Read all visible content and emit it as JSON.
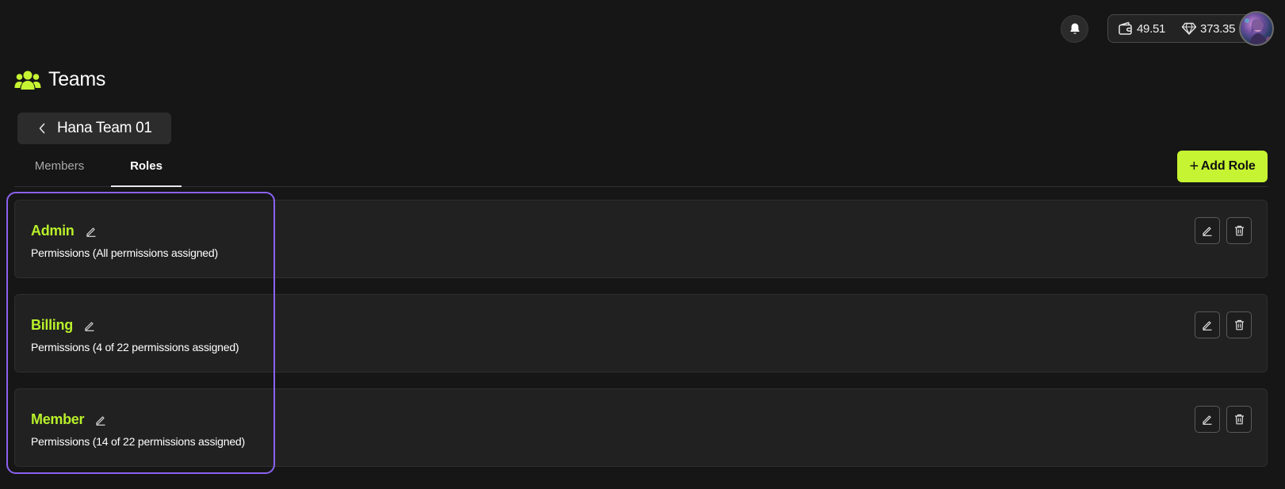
{
  "topbar": {
    "wallet_balance": "49.51",
    "gem_balance": "373.35",
    "icons": [
      "bell-icon",
      "wallet-icon",
      "diamond-icon"
    ]
  },
  "header": {
    "title": "Teams",
    "team_name": "Hana Team 01"
  },
  "tabs": [
    {
      "label": "Members",
      "active": false
    },
    {
      "label": "Roles",
      "active": true
    }
  ],
  "actions": {
    "add_role_label": "Add Role"
  },
  "roles": [
    {
      "name": "Admin",
      "permissions": "Permissions (All permissions assigned)"
    },
    {
      "name": "Billing",
      "permissions": "Permissions (4 of 22 permissions assigned)"
    },
    {
      "name": "Member",
      "permissions": "Permissions (14 of 22 permissions assigned)"
    }
  ],
  "colors": {
    "accent": "#c6f432",
    "role_name": "#b9f02b",
    "highlight": "#8b62f0",
    "background": "#161616",
    "card": "#212121"
  }
}
